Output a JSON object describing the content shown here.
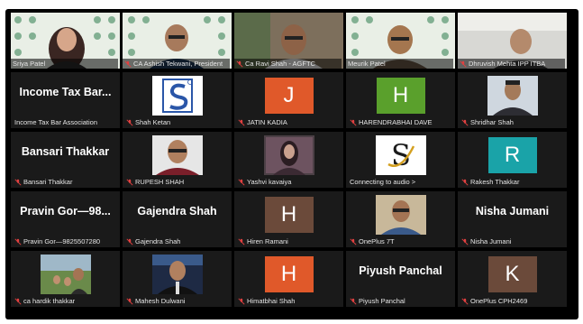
{
  "colors": {
    "frame_bg": "#000000",
    "tile_bg": "#1a1a1a",
    "active_speaker_outline": "#b6d64b",
    "muted_mic": "#e04040",
    "avatar_orange": "#e0592a",
    "avatar_green": "#5aa02c",
    "avatar_teal": "#1aa3a8",
    "avatar_brown": "#6b4a3a"
  },
  "tiles": [
    {
      "name": "Sriya Patel"
    },
    {
      "name": "CA Ashish Tekwani, President"
    },
    {
      "name": "Ca Ravi Shah - AGFTC"
    },
    {
      "name": "Meurik Patel"
    },
    {
      "name": "Dhruvish Mehta IPP ITBA"
    },
    {
      "name": "Income Tax Bar Association",
      "display": "Income Tax Bar..."
    },
    {
      "name": "Shah Ketan"
    },
    {
      "name": "JATIN KADIA",
      "initial": "J"
    },
    {
      "name": "HARENDRABHAI DAVE",
      "initial": "H"
    },
    {
      "name": "Shridhar Shah"
    },
    {
      "name": "Bansari Thakkar",
      "display": "Bansari Thakkar"
    },
    {
      "name": "RUPESH SHAH"
    },
    {
      "name": "Yashvi kavaiya"
    },
    {
      "name": "Connecting to audio >",
      "logo_text": "S"
    },
    {
      "name": "Rakesh Thakkar",
      "initial": "R"
    },
    {
      "name": "Pravin Gor—9825507280",
      "display": "Pravin Gor—98..."
    },
    {
      "name": "Gajendra Shah",
      "display": "Gajendra Shah"
    },
    {
      "name": "Hiren Ramani",
      "initial": "H"
    },
    {
      "name": "OnePlus 7T"
    },
    {
      "name": "Nisha Jumani",
      "display": "Nisha Jumani"
    },
    {
      "name": "ca hardik thakkar"
    },
    {
      "name": "Mahesh Dulwani"
    },
    {
      "name": "Himatbhai Shah",
      "initial": "H"
    },
    {
      "name": "Piyush Panchal",
      "display": "Piyush Panchal"
    },
    {
      "name": "OnePlus CPH2469",
      "initial": "K"
    }
  ]
}
